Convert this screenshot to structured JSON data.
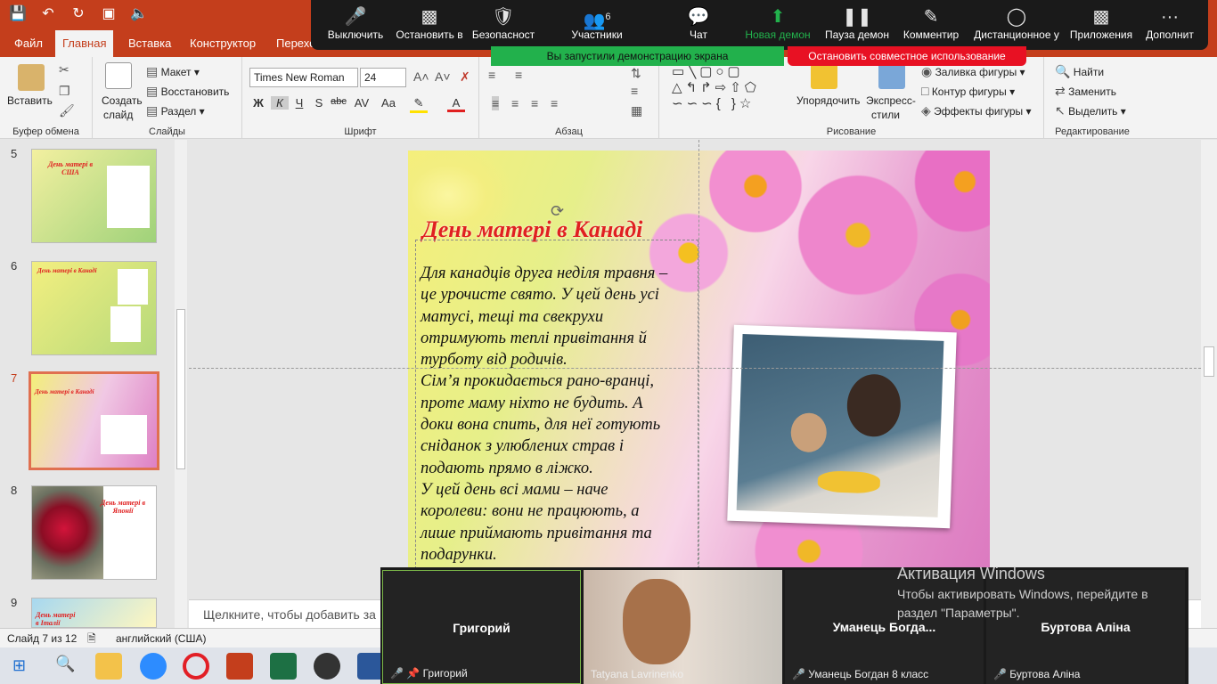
{
  "qat": {
    "save_icon": "save-icon",
    "undo_icon": "undo-icon",
    "redo_icon": "redo-icon",
    "present_icon": "present-icon",
    "audio_icon": "audio-icon"
  },
  "tabs": [
    {
      "label": "Файл"
    },
    {
      "label": "Главная"
    },
    {
      "label": "Вставка"
    },
    {
      "label": "Конструктор"
    },
    {
      "label": "Переход"
    }
  ],
  "zoom": {
    "items": [
      {
        "label": "Выключить",
        "icon": "mic-icon"
      },
      {
        "label": "Остановить в",
        "icon": "video-icon"
      },
      {
        "label": "Безопасност",
        "icon": "shield-icon"
      },
      {
        "label": "Участники",
        "icon": "participants-icon",
        "count": "6"
      },
      {
        "label": "Чат",
        "icon": "chat-icon"
      },
      {
        "label": "Новая демон",
        "icon": "share-icon"
      },
      {
        "label": "Пауза демон",
        "icon": "pause-icon"
      },
      {
        "label": "Комментир",
        "icon": "pen-icon"
      },
      {
        "label": "Дистанционное у",
        "icon": "mouse-icon"
      },
      {
        "label": "Приложения",
        "icon": "apps-icon"
      },
      {
        "label": "Дополнит",
        "icon": "more-icon"
      }
    ],
    "sharing_text": "Вы запустили демонстрацию экрана",
    "stop_text": "Остановить совместное использование"
  },
  "ribbon": {
    "clipboard": {
      "paste": "Вставить",
      "label": "Буфер обмена"
    },
    "slides": {
      "new_slide": "Создать",
      "new_slide2": "слайд",
      "layout": "Макет",
      "reset": "Восстановить",
      "section": "Раздел",
      "label": "Слайды"
    },
    "font": {
      "name": "Times New Roman",
      "size": "24",
      "label": "Шрифт"
    },
    "paragraph": {
      "label": "Абзац"
    },
    "drawing": {
      "arrange": "Упорядочить",
      "styles": "Экспресс-",
      "styles2": "стили",
      "fill": "Заливка фигуры",
      "outline": "Контур фигуры",
      "effects": "Эффекты фигуры",
      "label": "Рисование"
    },
    "editing": {
      "find": "Найти",
      "replace": "Заменить",
      "select": "Выделить",
      "label": "Редактирование"
    }
  },
  "thumbnails": {
    "items": [
      {
        "num": "5",
        "title": "День матері в США"
      },
      {
        "num": "6",
        "title": "День матері в Канаді"
      },
      {
        "num": "7",
        "title": "День матері в Канаді"
      },
      {
        "num": "8",
        "title": "День матері в Японії"
      },
      {
        "num": "9",
        "title": "День матері в Італії"
      }
    ]
  },
  "slide": {
    "title": "День матері в Канаді",
    "body": [
      "Для канадців друга неділя травня –",
      "це урочисте свято. У цей день усі",
      "матусі, тещі та свекрухи",
      "отримують теплі привітання й",
      "турботу від родичів.",
      "Сім’я прокидається рано-вранці,",
      "проте маму ніхто не будить. А",
      "доки вона спить, для неї готують",
      "сніданок з улюблених страв і",
      "подають прямо в ліжко.",
      "У цей день всі мами – наче",
      "королеви: вони не працюють, а",
      "лише приймають привітання та",
      "подарунки."
    ]
  },
  "notes_placeholder": "Щелкните, чтобы добавить за",
  "status": {
    "slide": "Слайд 7 из 12",
    "lang": "английский (США)"
  },
  "video": {
    "tiles": [
      {
        "name": "Григорий",
        "caption": "Григорий"
      },
      {
        "name": "",
        "caption": "Tatyana Lavrinenko"
      },
      {
        "name": "Уманець  Богда...",
        "caption": "Уманець Богдан 8 класс"
      },
      {
        "name": "Буртова Аліна",
        "caption": "Буртова Аліна"
      }
    ]
  },
  "activation": {
    "title": "Активация Windows",
    "line1": "Чтобы активировать Windows, перейдите в",
    "line2": "раздел \"Параметры\"."
  },
  "taskbar": {
    "apps": [
      "windows-icon",
      "search-icon",
      "explorer-icon",
      "zoom-icon",
      "opera-icon",
      "powerpoint-icon",
      "excel-icon",
      "media-icon",
      "word-icon"
    ]
  },
  "colors": {
    "accent": "#c43e1c",
    "title_red": "#e02020",
    "share_green": "#22b14c",
    "stop_red": "#e81123"
  }
}
